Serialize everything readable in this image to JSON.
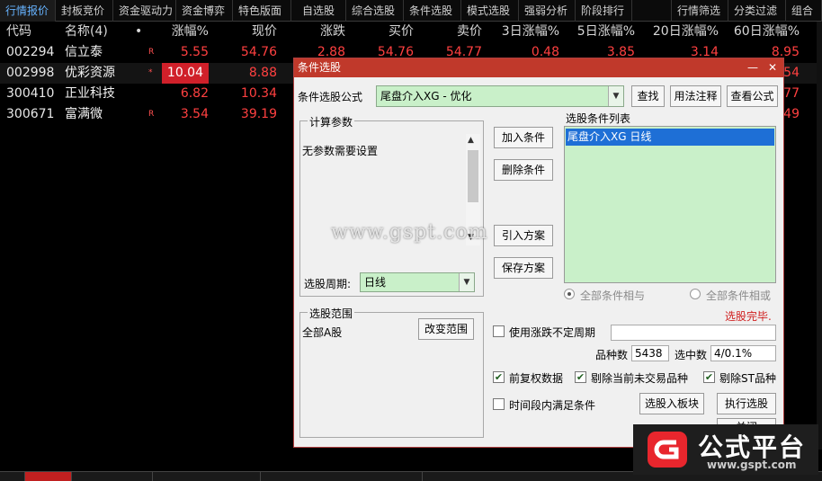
{
  "tabs": [
    "行情报价",
    "封板竞价",
    "资金驱动力",
    "资金博弈",
    "特色版面",
    "自选股",
    "综合选股",
    "条件选股",
    "模式选股",
    "强弱分析",
    "阶段排行",
    "",
    "行情筛选",
    "分类过滤",
    "组合"
  ],
  "table": {
    "headers": [
      "代码",
      "名称(4)",
      "•",
      "涨幅%",
      "现价",
      "涨跌",
      "买价",
      "卖价",
      "3日涨幅%",
      "5日涨幅%",
      "20日涨幅%",
      "60日涨幅%"
    ],
    "rows": [
      {
        "code": "002294",
        "name": "信立泰",
        "flag": "R",
        "chg": "5.55",
        "price": "54.76",
        "diff": "2.88",
        "bid": "54.76",
        "ask": "54.77",
        "d3": "0.48",
        "d5": "3.85",
        "d20": "3.14",
        "d60": "8.95"
      },
      {
        "code": "002998",
        "name": "优彩资源",
        "flag": "*",
        "chg": "10.04",
        "price": "8.88",
        "diff": "",
        "bid": "",
        "ask": "",
        "d3": "",
        "d5": "",
        "d20": "",
        "d60": "54"
      },
      {
        "code": "300410",
        "name": "正业科技",
        "flag": "",
        "chg": "6.82",
        "price": "10.34",
        "diff": "",
        "bid": "",
        "ask": "",
        "d3": "",
        "d5": "",
        "d20": "",
        "d60": "77"
      },
      {
        "code": "300671",
        "name": "富满微",
        "flag": "R",
        "chg": "3.54",
        "price": "39.19",
        "diff": "",
        "bid": "",
        "ask": "",
        "d3": "",
        "d5": "",
        "d20": "",
        "d60": "49"
      }
    ]
  },
  "dialog": {
    "title": "条件选股",
    "formula_label": "条件选股公式",
    "formula_value": "尾盘介入XG  -  优化",
    "find_btn": "查找",
    "usage_btn": "用法注释",
    "view_btn": "查看公式",
    "params_title": "计算参数",
    "params_text": "无参数需要设置",
    "add_btn": "加入条件",
    "del_btn": "删除条件",
    "import_btn": "引入方案",
    "save_btn": "保存方案",
    "list_title": "选股条件列表",
    "list_items": [
      "尾盘介入XG  日线"
    ],
    "period_label": "选股周期:",
    "period_value": "日线",
    "radio_and": "全部条件相与",
    "radio_or": "全部条件相或",
    "status": "选股完毕.",
    "range_title": "选股范围",
    "range_value": "全部A股",
    "change_range_btn": "改变范围",
    "uncertain_period": "使用涨跌不定周期",
    "count_label": "品种数",
    "count_value": "5438",
    "selected_label": "选中数",
    "selected_value": "4/0.1%",
    "forward_adj": "前复权数据",
    "exclude_untraded": "剔除当前未交易品种",
    "exclude_st": "剔除ST品种",
    "time_condition": "时间段内满足条件",
    "to_block_btn": "选股入板块",
    "execute_btn": "执行选股",
    "close_btn": "关闭"
  },
  "watermark": "www.gspt.com",
  "logo": {
    "text": "公式平台",
    "url": "www.gspt.com",
    "accent": "#e8262d"
  },
  "colors": {
    "up": "#ff4040",
    "tab_active": "#66b3ff",
    "dialog_title": "#c0392b",
    "list_bg": "#c9f0c9",
    "selected": "#1e6fd6"
  }
}
